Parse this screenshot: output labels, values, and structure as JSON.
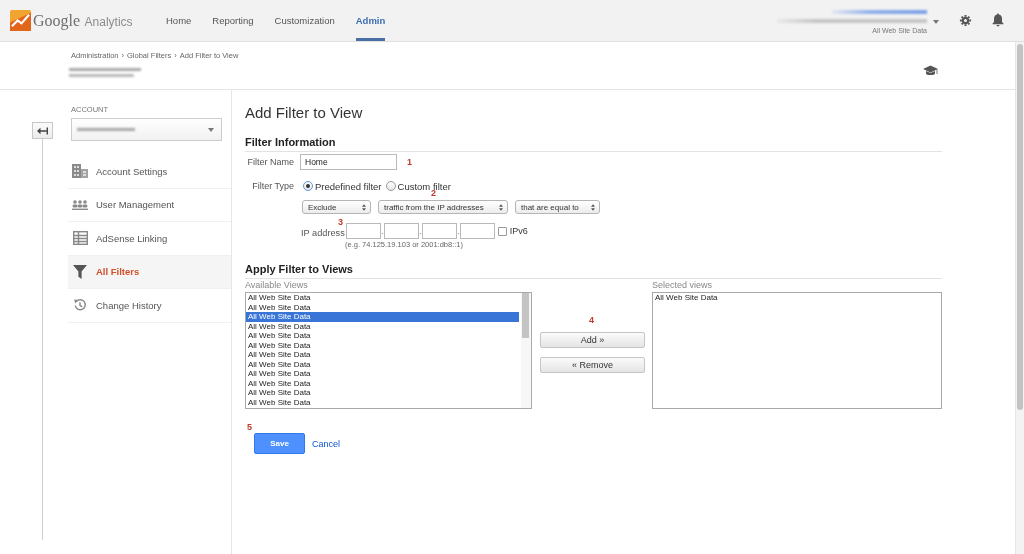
{
  "header": {
    "logo": {
      "first_word": "Google",
      "second_word": "Analytics"
    },
    "nav": [
      {
        "label": "Home",
        "selected": false
      },
      {
        "label": "Reporting",
        "selected": false
      },
      {
        "label": "Customization",
        "selected": false
      },
      {
        "label": "Admin",
        "selected": true
      }
    ],
    "view_name": "All Web Site Data"
  },
  "breadcrumb": {
    "separator": "›",
    "items": [
      "Administration",
      "Global Filters",
      "Add Filter to View"
    ]
  },
  "sidebar": {
    "section_label": "ACCOUNT",
    "items": [
      {
        "label": "Account Settings",
        "selected": false
      },
      {
        "label": "User Management",
        "selected": false
      },
      {
        "label": "AdSense Linking",
        "selected": false
      },
      {
        "label": "All Filters",
        "selected": true
      },
      {
        "label": "Change History",
        "selected": false
      }
    ]
  },
  "page_title": "Add Filter to View",
  "filter_information": {
    "heading": "Filter Information",
    "filter_name": {
      "label": "Filter Name",
      "value": "Home",
      "step": "1"
    },
    "filter_type": {
      "label": "Filter Type",
      "options": [
        {
          "label": "Predefined filter",
          "selected": true
        },
        {
          "label": "Custom filter",
          "selected": false
        }
      ],
      "step": "2",
      "selects": [
        "Exclude",
        "traffic from the IP addresses",
        "that are equal to"
      ]
    },
    "ip_address": {
      "label": "IP address",
      "step": "3",
      "separator": ".",
      "ipv6": {
        "label": "IPv6",
        "checked": false
      },
      "hint": "(e.g. 74.125.19.103 or 2001:db8::1)"
    }
  },
  "apply_filter": {
    "heading": "Apply Filter to Views",
    "available_views": {
      "label": "Available Views",
      "items": [
        {
          "label": "All Web Site Data",
          "selected": false
        },
        {
          "label": "All Web Site Data",
          "selected": false
        },
        {
          "label": "All Web Site Data",
          "selected": true
        },
        {
          "label": "All Web Site Data",
          "selected": false
        },
        {
          "label": "All Web Site Data",
          "selected": false
        },
        {
          "label": "All Web Site Data",
          "selected": false
        },
        {
          "label": "All Web Site Data",
          "selected": false
        },
        {
          "label": "All Web Site Data",
          "selected": false
        },
        {
          "label": "All Web Site Data",
          "selected": false
        },
        {
          "label": "All Web Site Data",
          "selected": false
        },
        {
          "label": "All Web Site Data",
          "selected": false
        },
        {
          "label": "All Web Site Data",
          "selected": false
        }
      ]
    },
    "step": "4",
    "add_button": "Add »",
    "remove_button": "« Remove",
    "selected_views": {
      "label": "Selected views",
      "items": [
        {
          "label": "All Web Site Data",
          "selected": false
        }
      ]
    }
  },
  "actions": {
    "step": "5",
    "save": "Save",
    "cancel": "Cancel"
  }
}
